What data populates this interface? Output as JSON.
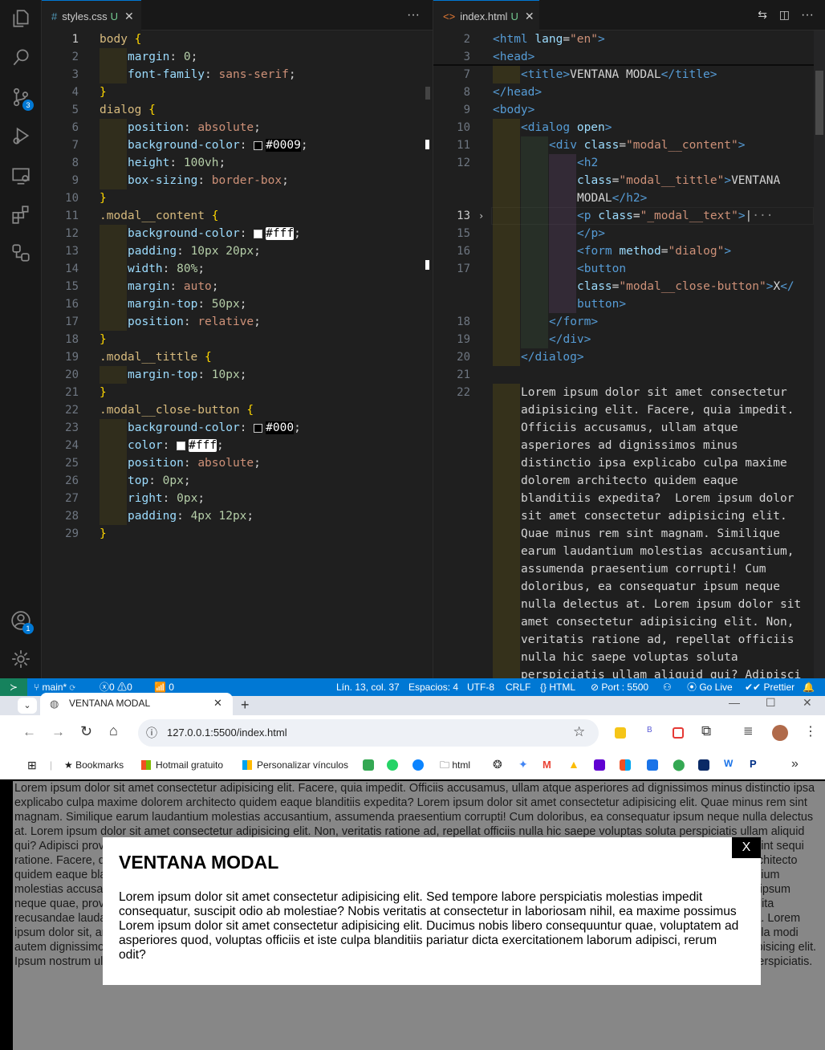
{
  "vscode": {
    "left_tab": {
      "icon": "#",
      "name": "styles.css",
      "status": "U"
    },
    "right_tab": {
      "name": "index.html",
      "status": "U"
    },
    "css_lines": [
      {
        "n": "1",
        "t": "body {"
      },
      {
        "n": "2",
        "t": "margin: 0;"
      },
      {
        "n": "3",
        "t": "font-family: sans-serif;"
      },
      {
        "n": "4",
        "t": "}"
      },
      {
        "n": "5",
        "t": "dialog {"
      },
      {
        "n": "6",
        "t": "position: absolute;"
      },
      {
        "n": "7",
        "t": "background-color: #0009;"
      },
      {
        "n": "8",
        "t": "height: 100vh;"
      },
      {
        "n": "9",
        "t": "box-sizing: border-box;"
      },
      {
        "n": "10",
        "t": "}"
      },
      {
        "n": "11",
        "t": ".modal__content {"
      },
      {
        "n": "12",
        "t": "background-color: #fff;"
      },
      {
        "n": "13",
        "t": "padding: 10px 20px;"
      },
      {
        "n": "14",
        "t": "width: 80%;"
      },
      {
        "n": "15",
        "t": "margin: auto;"
      },
      {
        "n": "16",
        "t": "margin-top: 50px;"
      },
      {
        "n": "17",
        "t": "position: relative;"
      },
      {
        "n": "18",
        "t": "}"
      },
      {
        "n": "19",
        "t": ".modal__tittle {"
      },
      {
        "n": "20",
        "t": "margin-top: 10px;"
      },
      {
        "n": "21",
        "t": "}"
      },
      {
        "n": "22",
        "t": ".modal__close-button {"
      },
      {
        "n": "23",
        "t": "background-color: #000;"
      },
      {
        "n": "24",
        "t": "color: #fff;"
      },
      {
        "n": "25",
        "t": "position: absolute;"
      },
      {
        "n": "26",
        "t": "top: 0px;"
      },
      {
        "n": "27",
        "t": "right: 0px;"
      },
      {
        "n": "28",
        "t": "padding: 4px 12px;"
      },
      {
        "n": "29",
        "t": "}"
      }
    ],
    "html_line_numbers": [
      "2",
      "3",
      "7",
      "8",
      "9",
      "10",
      "11",
      "12",
      "13",
      "15",
      "16",
      "17",
      "18",
      "19",
      "20",
      "21",
      "22"
    ],
    "html_lorem": [
      "Lorem ipsum dolor sit amet consectetur",
      "adipisicing elit. Facere, quia impedit.",
      "Officiis accusamus, ullam atque",
      "asperiores ad dignissimos minus",
      "distinctio ipsa explicabo culpa maxime",
      "dolorem architecto quidem eaque",
      "blanditiis expedita?  Lorem ipsum dolor",
      "sit amet consectetur adipisicing elit.",
      "Quae minus rem sint magnam. Similique",
      "earum laudantium molestias accusantium,",
      "assumenda praesentium corrupti! Cum",
      "doloribus, ea consequatur ipsum neque",
      "nulla delectus at. Lorem ipsum dolor sit",
      "amet consectetur adipisicing elit. Non,",
      "veritatis ratione ad, repellat officiis",
      "nulla hic saepe voluptas soluta",
      "perspiciatis ullam aliquid qui? Adipisci"
    ],
    "badges": {
      "scm": "3",
      "accounts": "1"
    }
  },
  "status_bar": {
    "branch": "main*",
    "errors": "0",
    "warnings": "0",
    "ports": "0",
    "position": "Lín. 13, col. 37",
    "spaces": "Espacios: 4",
    "encoding": "UTF-8",
    "eol": "CRLF",
    "language": "HTML",
    "port": "Port : 5500",
    "golive": "Go Live",
    "prettier": "Prettier"
  },
  "browser": {
    "tab_title": "VENTANA MODAL",
    "url": "127.0.0.1:5500/index.html",
    "bookmarks": [
      "Bookmarks",
      "Hotmail gratuito",
      "Personalizar vínculos",
      "html"
    ]
  },
  "page": {
    "background_text": "Lorem ipsum dolor sit amet consectetur adipisicing elit. Facere, quia impedit. Officiis accusamus, ullam atque asperiores ad dignissimos minus distinctio ipsa explicabo culpa maxime dolorem architecto quidem eaque blanditiis expedita? Lorem ipsum dolor sit amet consectetur adipisicing elit. Quae minus rem sint magnam. Similique earum laudantium molestias accusantium, assumenda praesentium corrupti! Cum doloribus, ea consequatur ipsum neque nulla delectus at. Lorem ipsum dolor sit amet consectetur adipisicing elit. Non, veritatis ratione ad, repellat officiis nulla hic saepe voluptas soluta perspiciatis ullam aliquid qui? Adipisci provident error sequi rerum. Lorem ipsum dolor, sit amet consectetur adipisicing elit. Quasi, delectus fugit nostrum et distinctio dicta sint sequi ratione. Facere, quia impedit. Officiis accusamus, ullam atque asperiores ad dignissimos minus distinctio ipsa explicabo culpa maxime dolorem architecto quidem eaque blanditiis expedita? Lorem ipsum dolor sit amet consectetur adipisicing elit. Quae minus rem sint magnam. Similique earum laudantium molestias accusantium, assumenda praesentium corrupti! Lorem ipsum dolor sit amet consectetur adipisicing elit. Cum doloribus, ea consequatur ipsum neque quae, provident error sequi rerum dicta cupiditate repellat. Ea ut laudantium! Lorem ipsum dolor sit amet, consectetur adipisicing elit. Expedita recusandae laudantium ipsum odit nulla modi autem dignissimos! Iure natus fugiat in eum! Iusto neque nisi sed doloribus voluptatem tempore ipsa. Lorem ipsum dolor sit, amet consectetur adipisicing rem ipsum dolor sit amet, consectetur adipisicing elit. Expedita recusandae laudantium ipsum odit nulla modi autem dignissimos! Iure natus fugiat in eum! Iusto neque nisi sed doloribus voluptatem tempore ipsa. Lorem ipsum dolor sit, amet consectetur adipisicing elit. Ipsum nostrum ullam accusamus! Sed quas doloribus beatae qui aliquid sunt et fuga aut quisquam, facere, ipsam sint voluptatem adipisci natus perspiciatis.",
    "modal_title": "VENTANA MODAL",
    "modal_text": "Lorem ipsum dolor sit amet consectetur adipisicing elit. Sed tempore labore perspiciatis molestias impedit consequatur, suscipit odio ab molestiae? Nobis veritatis at consectetur in laboriosam nihil, ea maxime possimus Lorem ipsum dolor sit amet consectetur adipisicing elit. Ducimus nobis libero consequuntur quae, voluptatem ad asperiores quod, voluptas officiis et iste culpa blanditiis pariatur dicta exercitationem laborum adipisci, rerum odit?",
    "close_label": "X"
  }
}
